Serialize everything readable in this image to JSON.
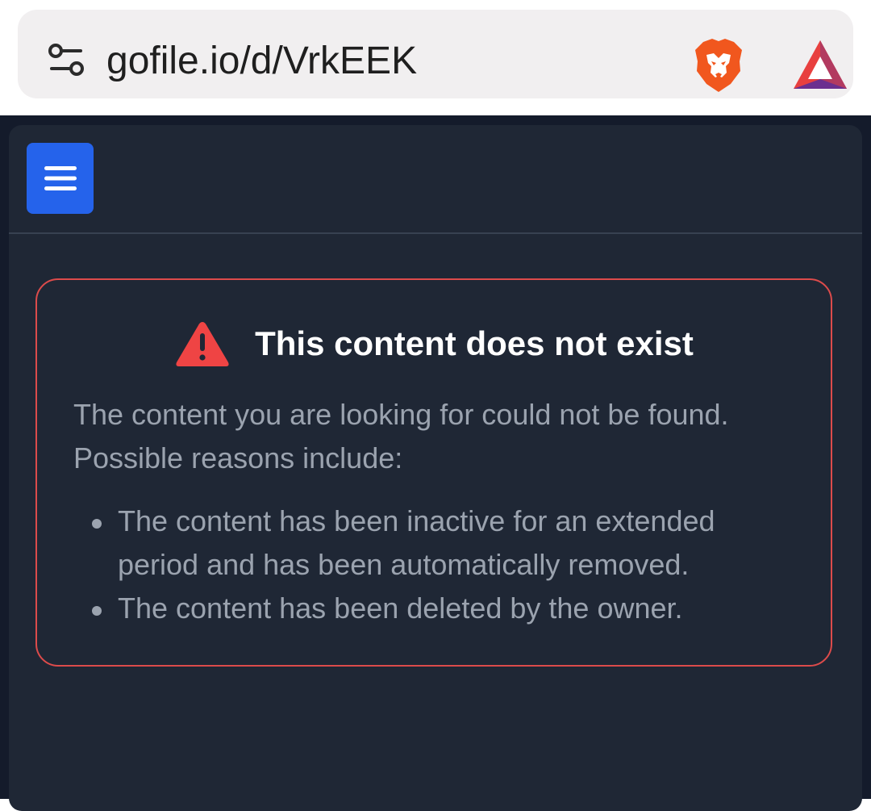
{
  "browser": {
    "url": "gofile.io/d/VrkEEK",
    "icons": [
      "site-settings-icon",
      "brave-shields-icon",
      "brave-rewards-icon"
    ]
  },
  "page": {
    "menu_icon": "hamburger-menu-icon",
    "alert": {
      "icon": "warning-icon",
      "title": "This content does not exist",
      "description": "The content you are looking for could not be found. Possible reasons include:",
      "reasons": [
        "The content has been inactive for an extended period and has been automatically removed.",
        "The content has been deleted by the owner."
      ]
    }
  },
  "colors": {
    "page_background": "#141b2b",
    "panel_background": "#1f2735",
    "menu_button": "#2563eb",
    "alert_border": "#dc4b4b",
    "warning_red": "#ef4444",
    "text_muted": "#9ba3af"
  }
}
